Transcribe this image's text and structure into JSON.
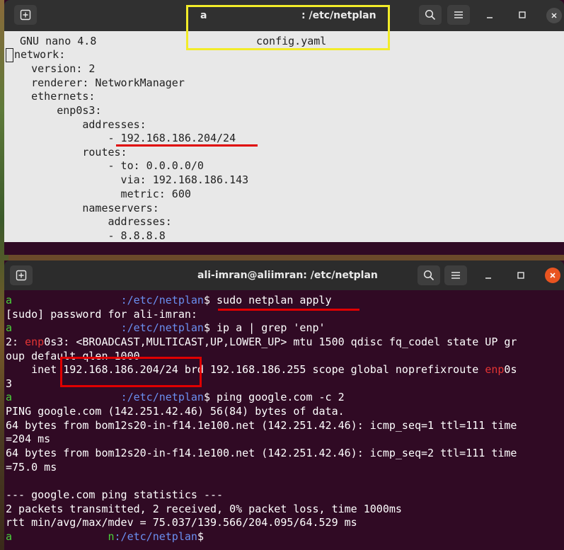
{
  "nano_window": {
    "title_user": "a",
    "title_path": ": /etc/netplan",
    "editor_header_left": "GNU nano 4.8",
    "editor_header_file": "config.yaml",
    "lines": [
      "network:",
      "    version: 2",
      "    renderer: NetworkManager",
      "    ethernets:",
      "        enp0s3:",
      "            addresses:",
      "                - 192.168.186.204/24",
      "            routes:",
      "                - to: 0.0.0.0/0",
      "                  via: 192.168.186.143",
      "                  metric: 600",
      "            nameservers:",
      "                addresses:",
      "                - 8.8.8.8"
    ]
  },
  "terminal_window": {
    "title": "ali-imran@aliimran: /etc/netplan",
    "prompt_user": "a",
    "prompt_path": ":/etc/netplan",
    "prompt_symbol": "$",
    "cmd1": " sudo netplan apply",
    "out_sudo": "[sudo] password for ali-imran:",
    "cmd2": " ip a | grep 'enp'",
    "out_ip1_prefix": "2: ",
    "out_ip1_iface": "enp",
    "out_ip1_rest": "0s3: <BROADCAST,MULTICAST,UP,LOWER_UP> mtu 1500 qdisc fq_codel state UP gr",
    "out_ip2": "oup default qlen 1000",
    "out_ip3_prefix": "    inet ",
    "out_ip3_addr": "192.168.186.204/24",
    "out_ip3_rest": " brd 192.168.186.255 scope global noprefixroute ",
    "out_ip3_iface": "enp",
    "out_ip3_tail": "0s",
    "out_ip4": "3",
    "cmd3": " ping google.com -c 2",
    "out_ping1": "PING google.com (142.251.42.46) 56(84) bytes of data.",
    "out_ping2": "64 bytes from bom12s20-in-f14.1e100.net (142.251.42.46): icmp_seq=1 ttl=111 time",
    "out_ping3": "=204 ms",
    "out_ping4": "64 bytes from bom12s20-in-f14.1e100.net (142.251.42.46): icmp_seq=2 ttl=111 time",
    "out_ping5": "=75.0 ms",
    "out_stats1": "--- google.com ping statistics ---",
    "out_stats2": "2 packets transmitted, 2 received, 0% packet loss, time 1000ms",
    "out_stats3": "rtt min/avg/max/mdev = 75.037/139.566/204.095/64.529 ms",
    "last_prompt_user": "a",
    "last_prompt_fragment": "n",
    "last_prompt_path": ":/etc/netplan",
    "last_prompt_symbol": "$"
  },
  "icons": {
    "new_tab": "new-tab-icon",
    "search": "search-icon",
    "menu": "hamburger-menu-icon",
    "minimize": "minimize-icon",
    "maximize": "maximize-icon",
    "close": "close-icon"
  },
  "colors": {
    "terminal_bg": "#300a24",
    "prompt_green": "#4ad13a",
    "path_blue": "#6a8ff0",
    "iface_red": "#e33434",
    "annotation_yellow": "#f2ec29",
    "annotation_red": "#e00000",
    "close_orange": "#e95420"
  }
}
